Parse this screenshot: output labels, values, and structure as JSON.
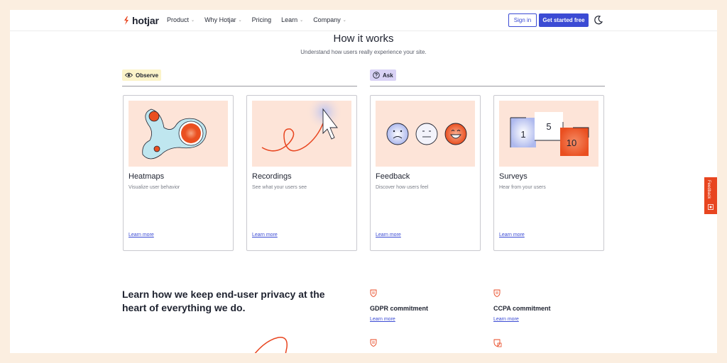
{
  "nav": {
    "brand": "hotjar",
    "items": [
      {
        "label": "Product",
        "dropdown": true
      },
      {
        "label": "Why Hotjar",
        "dropdown": true
      },
      {
        "label": "Pricing",
        "dropdown": false
      },
      {
        "label": "Learn",
        "dropdown": true
      },
      {
        "label": "Company",
        "dropdown": true
      }
    ],
    "chevron": "⌄",
    "sign_in": "Sign in",
    "cta": "Get started free"
  },
  "header": {
    "title": "How it works",
    "subtitle": "Understand how users really experience your site."
  },
  "sections": {
    "observe": "Observe",
    "ask": "Ask"
  },
  "cards": [
    {
      "title": "Heatmaps",
      "desc": "Visualize user behavior",
      "link": "Learn more"
    },
    {
      "title": "Recordings",
      "desc": "See what your users see",
      "link": "Learn more"
    },
    {
      "title": "Feedback",
      "desc": "Discover how users feel",
      "link": "Learn more"
    },
    {
      "title": "Surveys",
      "desc": "Hear from your users",
      "link": "Learn more",
      "numbers": [
        "1",
        "5",
        "10"
      ]
    }
  ],
  "privacy": {
    "heading": "Learn how we keep end-user privacy at the heart of everything we do.",
    "items": [
      {
        "title": "GDPR commitment",
        "link": "Learn more"
      },
      {
        "title": "CCPA commitment",
        "link": "Learn more"
      }
    ]
  },
  "feedback_tab": "Feedback",
  "colors": {
    "accent": "#3b4bd4",
    "brand_orange": "#e8451f",
    "page_bg": "#fbeee0",
    "card_art_bg": "#fde4d8"
  }
}
